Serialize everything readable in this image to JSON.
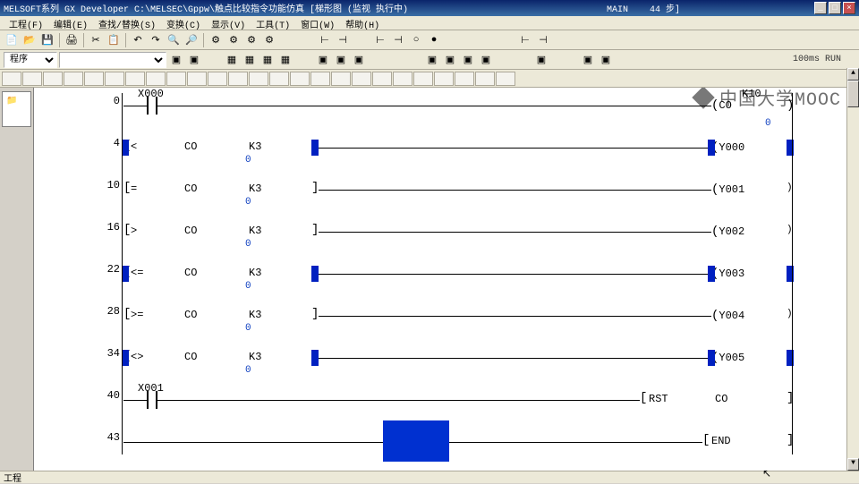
{
  "title": {
    "app": "MELSOFT系列 GX Developer C:\\MELSEC\\Gppw\\触点比较指令功能仿真    [梯形图 (监视 执行中)",
    "main": "MAIN",
    "steps": "44 步]"
  },
  "menu": [
    "工程(F)",
    "编辑(E)",
    "查找/替换(S)",
    "变换(C)",
    "显示(V)",
    "工具(T)",
    "窗口(W)",
    "帮助(H)"
  ],
  "dropdown1": "程序",
  "toolbar2_info": "100ms   RUN",
  "ladder": {
    "rungs": [
      {
        "step": "0",
        "contact_label": "X000",
        "out_left": "",
        "out_right": "CO",
        "k_right": "K10",
        "val_right": "0",
        "hl_left": false,
        "hl_mid": false,
        "hl_right": false,
        "cmp": "",
        "type": "contact"
      },
      {
        "step": "4",
        "contact_label": "",
        "c1": "CO",
        "c2": "K3",
        "cv": "0",
        "out": "Y000",
        "hl_left": true,
        "hl_mid": true,
        "hl_right": true,
        "cmp": "<",
        "type": "cmp"
      },
      {
        "step": "10",
        "contact_label": "",
        "c1": "CO",
        "c2": "K3",
        "cv": "0",
        "out": "Y001",
        "hl_left": false,
        "hl_mid": false,
        "hl_right": false,
        "cmp": "=",
        "type": "cmp"
      },
      {
        "step": "16",
        "contact_label": "",
        "c1": "CO",
        "c2": "K3",
        "cv": "0",
        "out": "Y002",
        "hl_left": false,
        "hl_mid": false,
        "hl_right": false,
        "cmp": ">",
        "type": "cmp"
      },
      {
        "step": "22",
        "contact_label": "",
        "c1": "CO",
        "c2": "K3",
        "cv": "0",
        "out": "Y003",
        "hl_left": true,
        "hl_mid": true,
        "hl_right": true,
        "cmp": "<=",
        "type": "cmp"
      },
      {
        "step": "28",
        "contact_label": "",
        "c1": "CO",
        "c2": "K3",
        "cv": "0",
        "out": "Y004",
        "hl_left": false,
        "hl_mid": false,
        "hl_right": false,
        "cmp": ">=",
        "type": "cmp"
      },
      {
        "step": "34",
        "contact_label": "",
        "c1": "CO",
        "c2": "K3",
        "cv": "0",
        "out": "Y005",
        "hl_left": true,
        "hl_mid": true,
        "hl_right": true,
        "cmp": "<>",
        "type": "cmp"
      },
      {
        "step": "40",
        "contact_label": "X001",
        "inst": "RST",
        "op": "CO",
        "type": "inst"
      },
      {
        "step": "43",
        "inst": "END",
        "type": "end"
      }
    ]
  },
  "watermark": "中国大学MOOC",
  "status": "工程"
}
